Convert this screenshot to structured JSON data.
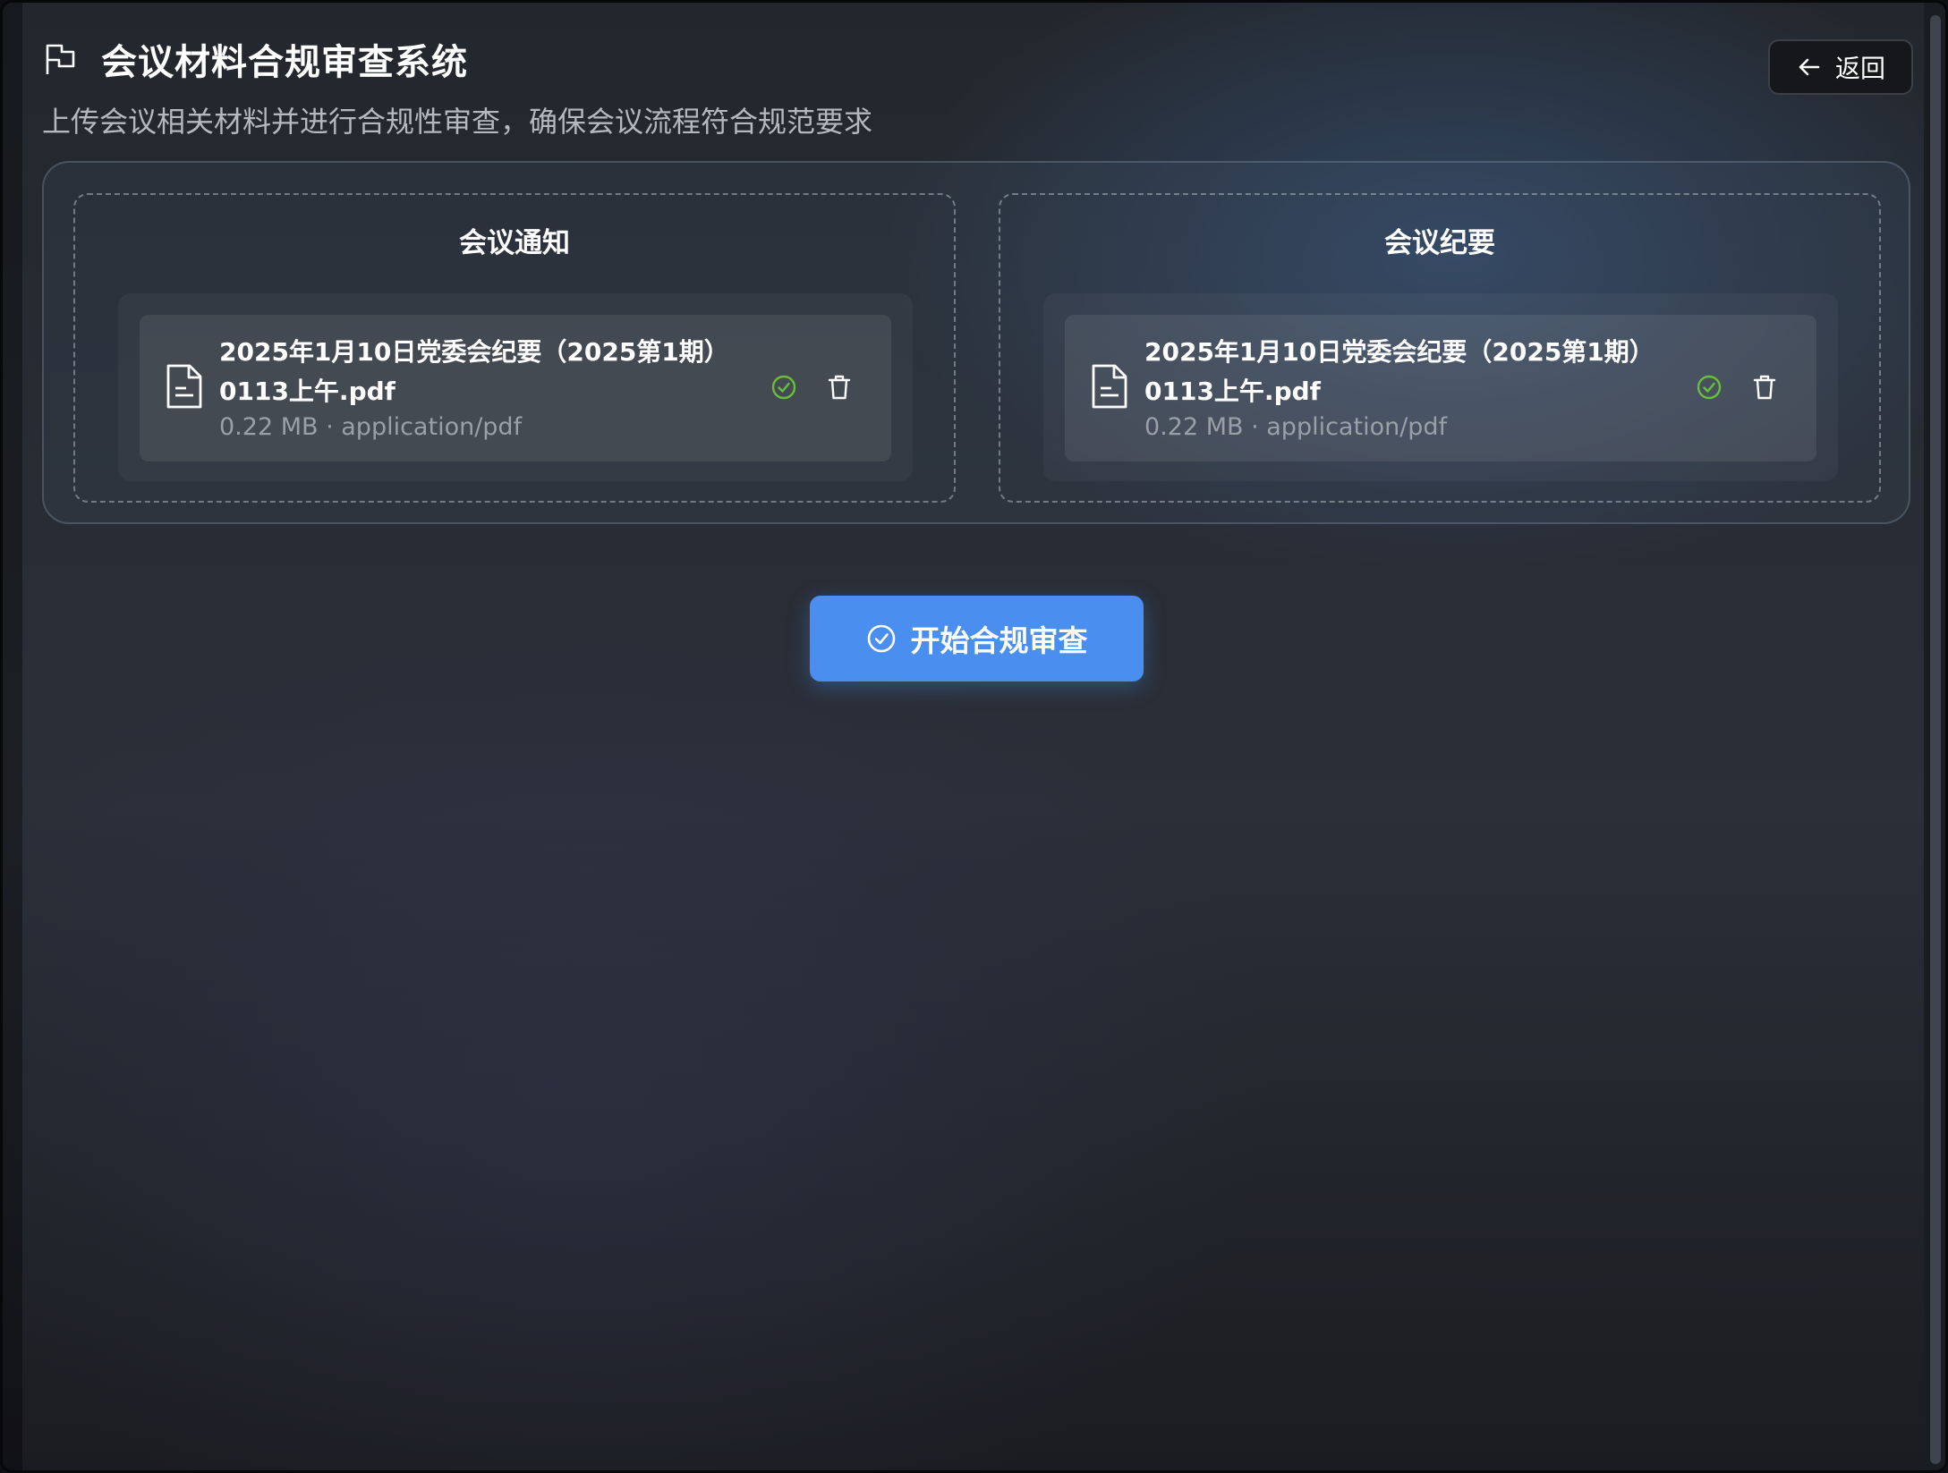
{
  "header": {
    "title": "会议材料合规审查系统",
    "subtitle": "上传会议相关材料并进行合规性审查，确保会议流程符合规范要求",
    "back_label": "返回",
    "title_icon": "flag-icon"
  },
  "upload_zones": [
    {
      "title": "会议通知",
      "file": {
        "name": "2025年1月10日党委会纪要（2025第1期）0113上午.pdf",
        "meta": "0.22 MB · application/pdf",
        "status_icon": "check-circle-icon",
        "status_color": "#6abf3a"
      }
    },
    {
      "title": "会议纪要",
      "file": {
        "name": "2025年1月10日党委会纪要（2025第1期）0113上午.pdf",
        "meta": "0.22 MB · application/pdf",
        "status_icon": "check-circle-icon",
        "status_color": "#6abf3a"
      }
    }
  ],
  "actions": {
    "start_review_label": "开始合规审查",
    "accent_color": "#4a8ff0"
  }
}
